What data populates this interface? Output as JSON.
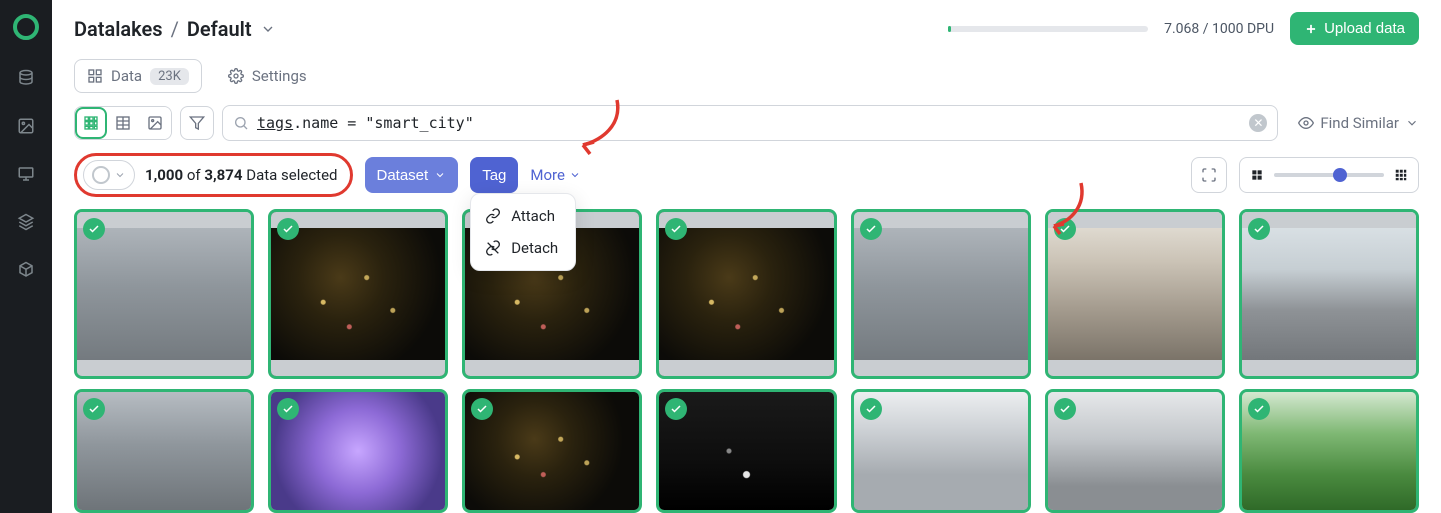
{
  "breadcrumb": {
    "root": "Datalakes",
    "current": "Default"
  },
  "dpu": {
    "used": "7.068",
    "total": "1000",
    "unit": "DPU"
  },
  "upload_label": "Upload data",
  "tabs": {
    "data": {
      "label": "Data",
      "badge": "23K"
    },
    "settings": {
      "label": "Settings"
    }
  },
  "search": {
    "prefix": "tags",
    "rest": ".name = \"smart_city\""
  },
  "find_similar_label": "Find Similar",
  "selection": {
    "count": "1,000",
    "total": "3,874",
    "of": "of",
    "suffix": "Data selected"
  },
  "actions": {
    "dataset": "Dataset",
    "tag": "Tag",
    "more": "More"
  },
  "tag_menu": {
    "attach": "Attach",
    "detach": "Detach"
  },
  "zoom": {
    "percent": 60
  },
  "thumbs_row1": [
    "sc-day-road",
    "sc-night",
    "sc-night",
    "sc-night",
    "sc-day-road",
    "sc-city",
    "sc-sky-road"
  ],
  "thumbs_row2": [
    "sc-day-road",
    "sc-purple",
    "sc-night",
    "sc-dark-road",
    "sc-bldg",
    "sc-overpass",
    "sc-green"
  ]
}
